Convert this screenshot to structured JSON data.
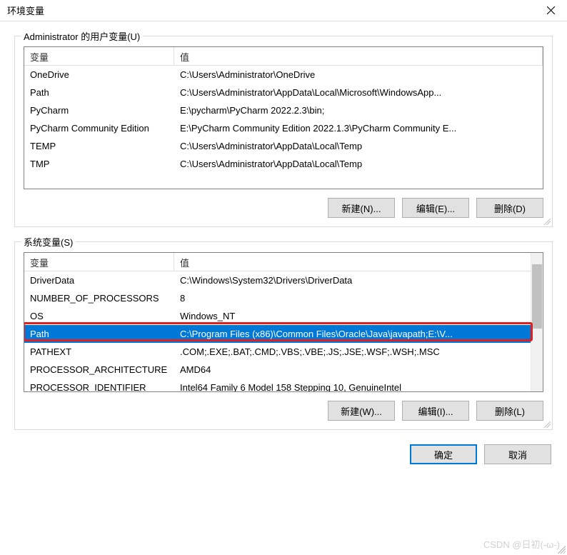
{
  "titlebar": {
    "title": "环境变量"
  },
  "userGroup": {
    "label": "Administrator 的用户变量(U)",
    "header": {
      "var": "变量",
      "val": "值"
    },
    "rows": [
      {
        "var": "OneDrive",
        "val": "C:\\Users\\Administrator\\OneDrive"
      },
      {
        "var": "Path",
        "val": "C:\\Users\\Administrator\\AppData\\Local\\Microsoft\\WindowsApp..."
      },
      {
        "var": "PyCharm",
        "val": "E:\\pycharm\\PyCharm 2022.2.3\\bin;"
      },
      {
        "var": "PyCharm Community Edition",
        "val": "E:\\PyCharm Community Edition 2022.1.3\\PyCharm Community E..."
      },
      {
        "var": "TEMP",
        "val": "C:\\Users\\Administrator\\AppData\\Local\\Temp"
      },
      {
        "var": "TMP",
        "val": "C:\\Users\\Administrator\\AppData\\Local\\Temp"
      }
    ],
    "buttons": {
      "new": "新建(N)...",
      "edit": "编辑(E)...",
      "delete": "删除(D)"
    }
  },
  "systemGroup": {
    "label": "系统变量(S)",
    "header": {
      "var": "变量",
      "val": "值"
    },
    "rows": [
      {
        "var": "DriverData",
        "val": "C:\\Windows\\System32\\Drivers\\DriverData"
      },
      {
        "var": "NUMBER_OF_PROCESSORS",
        "val": "8"
      },
      {
        "var": "OS",
        "val": "Windows_NT"
      },
      {
        "var": "Path",
        "val": "C:\\Program Files (x86)\\Common Files\\Oracle\\Java\\javapath;E:\\V..."
      },
      {
        "var": "PATHEXT",
        "val": ".COM;.EXE;.BAT;.CMD;.VBS;.VBE;.JS;.JSE;.WSF;.WSH;.MSC"
      },
      {
        "var": "PROCESSOR_ARCHITECTURE",
        "val": "AMD64"
      },
      {
        "var": "PROCESSOR_IDENTIFIER",
        "val": "Intel64 Family 6 Model 158 Stepping 10, GenuineIntel"
      }
    ],
    "selectedIndex": 3,
    "buttons": {
      "new": "新建(W)...",
      "edit": "编辑(I)...",
      "delete": "删除(L)"
    }
  },
  "dialogButtons": {
    "ok": "确定",
    "cancel": "取消"
  },
  "watermark": "CSDN @日初(-ω-)"
}
